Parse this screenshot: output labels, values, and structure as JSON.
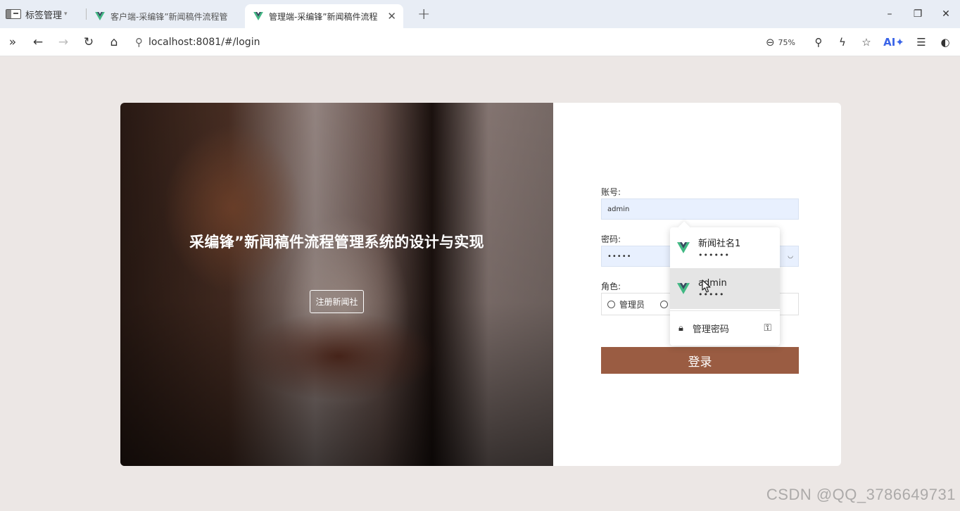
{
  "browser": {
    "tab_manager_label": "标签管理",
    "tabs": [
      {
        "label": "客户端-采编锋”新闻稿件流程管",
        "active": false
      },
      {
        "label": "管理端-采编锋”新闻稿件流程",
        "active": true
      }
    ],
    "new_tab": "+",
    "url": "localhost:8081/#/login",
    "zoom": "75%",
    "ai_label": "AI✦",
    "window_controls": [
      "–",
      "❐",
      "✕"
    ]
  },
  "hero": {
    "title": "采编锋”新闻稿件流程管理系统的设计与实现",
    "register_button": "注册新闻社"
  },
  "form": {
    "account_label": "账号:",
    "account_value": "admin",
    "password_label": "密码:",
    "password_value": "•••••",
    "role_label": "角色:",
    "role_options": [
      "管理员",
      ""
    ],
    "login_button": "登录"
  },
  "autofill": {
    "items": [
      {
        "name": "新闻社名1",
        "masked": "••••••"
      },
      {
        "name": "admin",
        "masked": "•••••"
      }
    ],
    "manage_label": "管理密码"
  },
  "watermark": "CSDN @QQ_3786649731",
  "colors": {
    "login_button": "#9a5c42",
    "input_fill": "#e8f0fe",
    "vue_green": "#41b883",
    "vue_dark": "#35495e"
  }
}
